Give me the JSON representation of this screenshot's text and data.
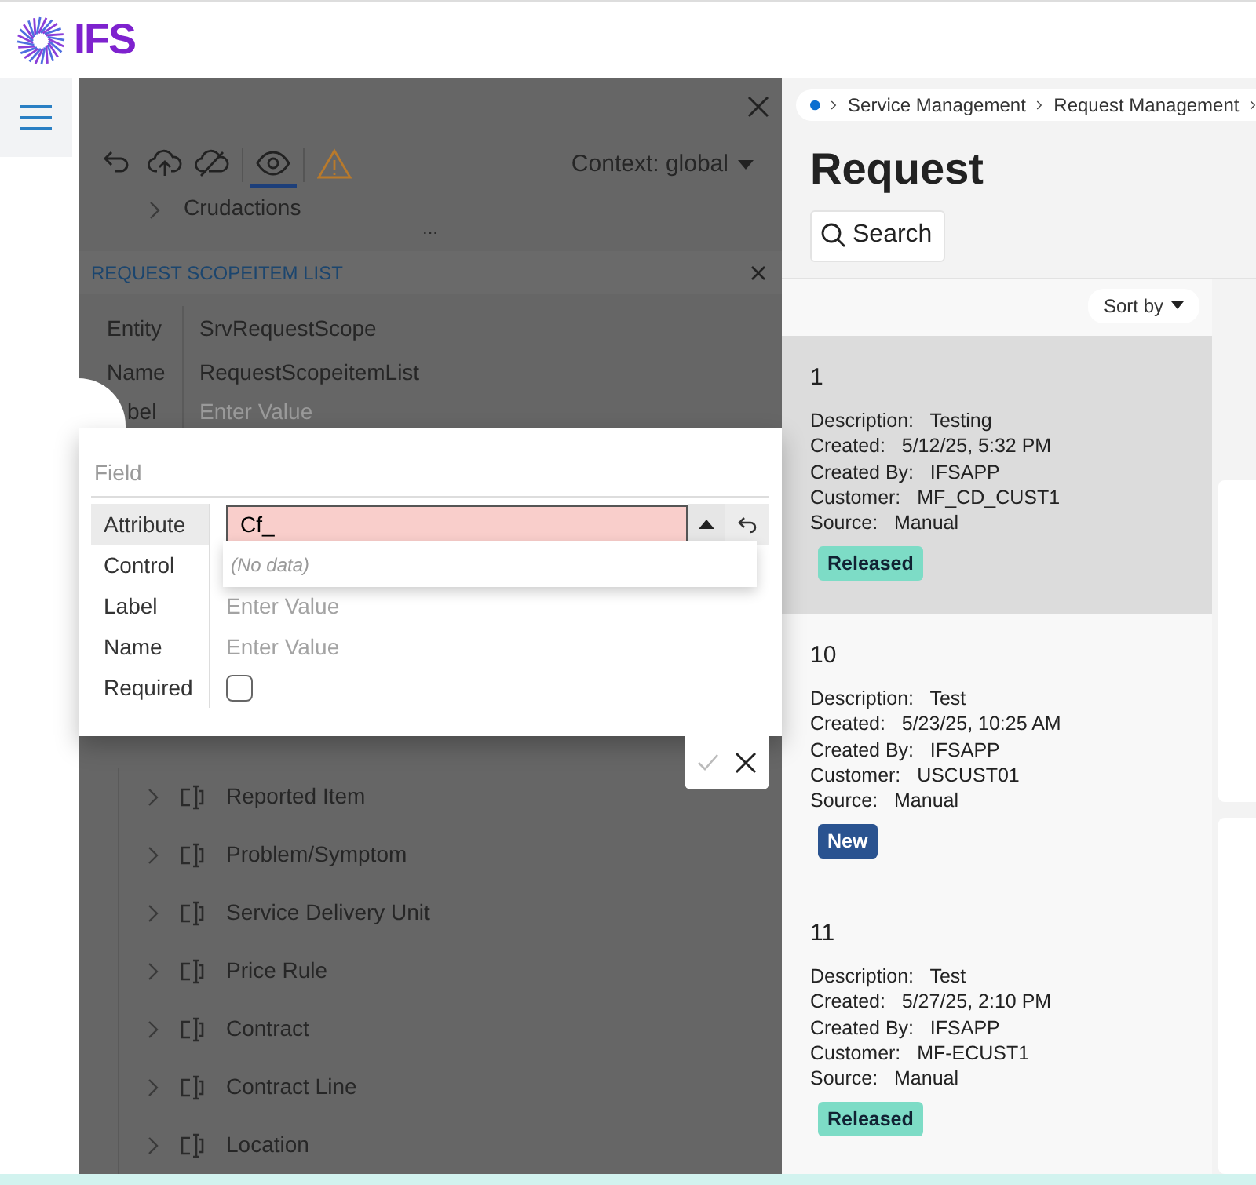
{
  "header": {
    "logo": "IFS"
  },
  "panel": {
    "toolbar": [
      {
        "kind": "undo",
        "selected": false
      },
      {
        "kind": "upload",
        "selected": false
      },
      {
        "kind": "cloud-off",
        "selected": false
      },
      {
        "kind": "eye",
        "selected": true
      },
      {
        "kind": "warning",
        "selected": false
      }
    ],
    "context": "Context: global",
    "top_item": "Crudactions",
    "more": "...",
    "section": {
      "title": "REQUEST SCOPEITEM LIST",
      "rows": [
        {
          "label": "Entity",
          "value": "SrvRequestScope"
        },
        {
          "label": "Name",
          "value": "RequestScopeitemList"
        },
        {
          "label": "bel",
          "placeholder": "Enter Value"
        }
      ]
    },
    "tree": [
      "Reported Item",
      "Problem/Symptom",
      "Service Delivery Unit",
      "Price Rule",
      "Contract",
      "Contract Line",
      "Location"
    ]
  },
  "popup": {
    "title": "Field",
    "rows": [
      {
        "label": "Attribute",
        "kind": "combo",
        "value": "Cf_",
        "invalid": true,
        "selected": true
      },
      {
        "label": "Control",
        "kind": "covered",
        "selected": false
      },
      {
        "label": "Label",
        "kind": "text",
        "placeholder": "Enter Value",
        "selected": false
      },
      {
        "label": "Name",
        "kind": "text",
        "placeholder": "Enter Value",
        "selected": false
      },
      {
        "label": "Required",
        "kind": "checkbox",
        "checked": false,
        "selected": false
      }
    ],
    "dropdown": "(No data)"
  },
  "breadcrumb": [
    "Service Management",
    "Request Management"
  ],
  "page_title": "Request",
  "search": "Search",
  "sort": "Sort by",
  "requests": [
    {
      "number": "1",
      "selected": true,
      "fields": [
        {
          "label": "Description:",
          "value": "Testing"
        },
        {
          "label": "Created:",
          "value": "5/12/25, 5:32 PM"
        },
        {
          "label": "Created By:",
          "value": "IFSAPP"
        },
        {
          "label": "Customer:",
          "value": "MF_CD_CUST1"
        },
        {
          "label": "Source:",
          "value": "Manual"
        }
      ],
      "status": {
        "text": "Released",
        "kind": "released"
      }
    },
    {
      "number": "10",
      "selected": false,
      "fields": [
        {
          "label": "Description:",
          "value": "Test"
        },
        {
          "label": "Created:",
          "value": "5/23/25, 10:25 AM"
        },
        {
          "label": "Created By:",
          "value": "IFSAPP"
        },
        {
          "label": "Customer:",
          "value": "USCUST01"
        },
        {
          "label": "Source:",
          "value": "Manual"
        }
      ],
      "status": {
        "text": "New",
        "kind": "new"
      }
    },
    {
      "number": "11",
      "selected": false,
      "fields": [
        {
          "label": "Description:",
          "value": "Test"
        },
        {
          "label": "Created:",
          "value": "5/27/25, 2:10 PM"
        },
        {
          "label": "Created By:",
          "value": "IFSAPP"
        },
        {
          "label": "Customer:",
          "value": "MF-ECUST1"
        },
        {
          "label": "Source:",
          "value": "Manual"
        }
      ],
      "status": {
        "text": "Released",
        "kind": "released"
      }
    }
  ]
}
